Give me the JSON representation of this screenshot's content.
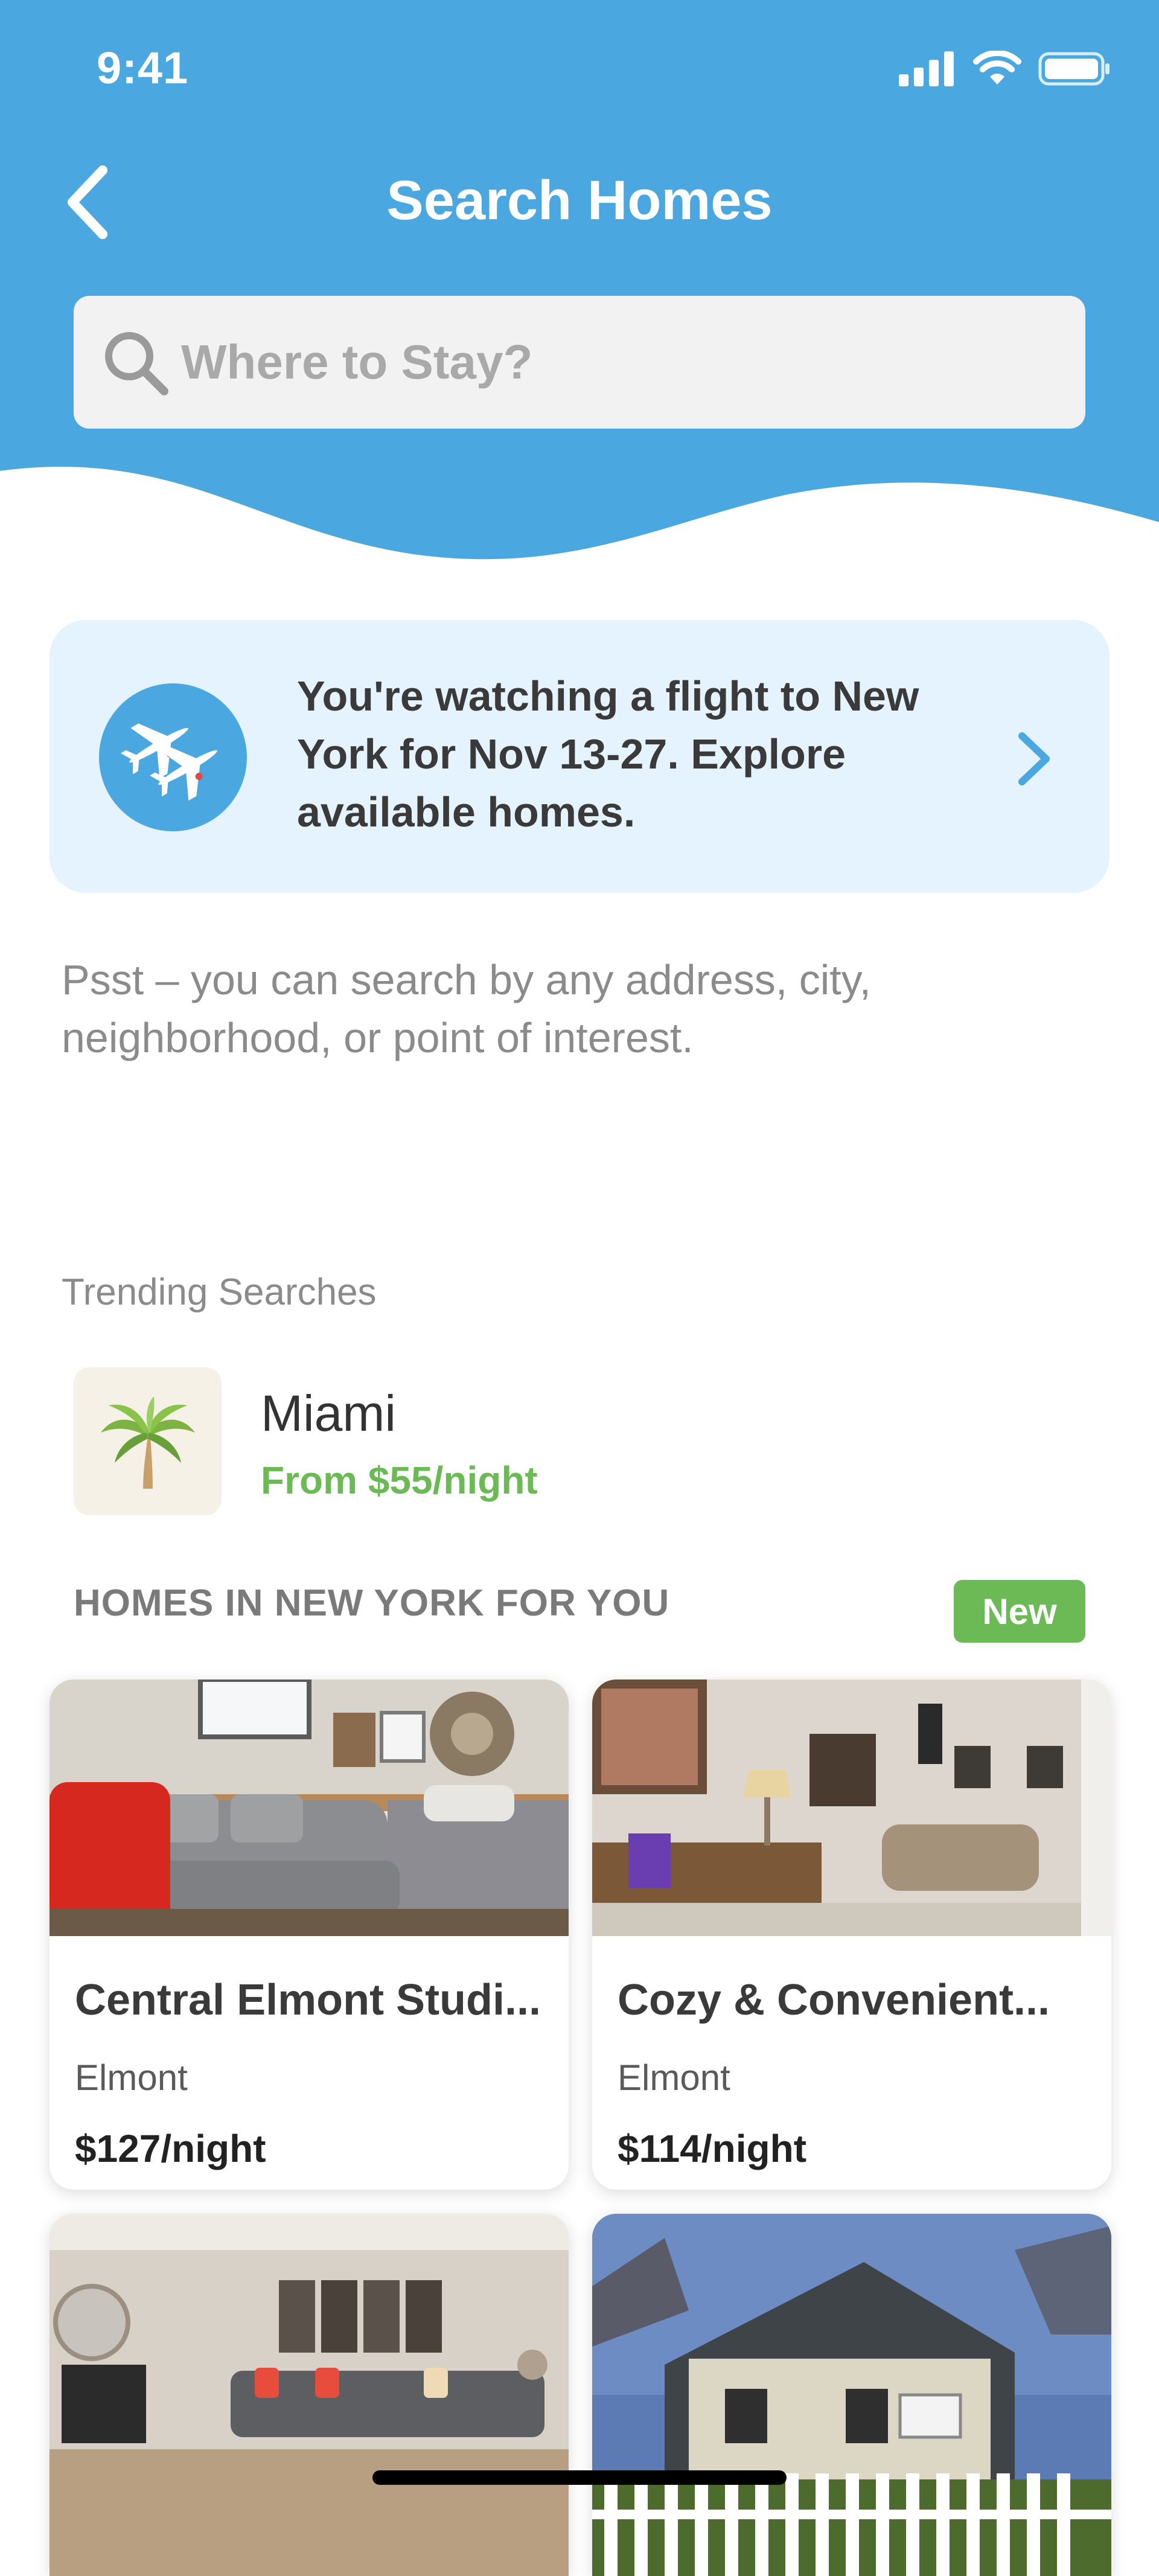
{
  "status_bar": {
    "time": "9:41"
  },
  "header": {
    "title": "Search Homes"
  },
  "search": {
    "placeholder": "Where to Stay?"
  },
  "flight_banner": {
    "text": "You're watching a flight to New York for Nov 13-27. Explore available homes."
  },
  "tip": {
    "text": "Psst – you can search by any address, city, neighborhood, or point of interest."
  },
  "trending": {
    "label": "Trending Searches",
    "items": [
      {
        "city": "Miami",
        "price": "From $55/night",
        "icon": "palm-tree-icon"
      }
    ]
  },
  "homes": {
    "label": "HOMES IN NEW YORK FOR YOU",
    "badge": "New",
    "listings": [
      {
        "title": "Central Elmont Studi...",
        "location": "Elmont",
        "price": "$127/night"
      },
      {
        "title": "Cozy & Convenient...",
        "location": "Elmont",
        "price": "$114/night"
      }
    ]
  },
  "colors": {
    "brand_blue": "#4aa7df",
    "banner_bg": "#e4f3fd",
    "accent_green": "#6bba55"
  }
}
